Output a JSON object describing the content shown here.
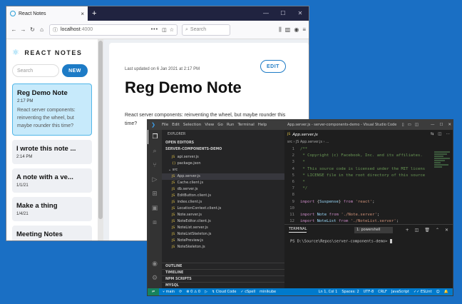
{
  "browser": {
    "tab_title": "React Notes",
    "tab_close": "×",
    "new_tab": "+",
    "url_host": "localhost",
    "url_port": ":4000",
    "url_more": "•••",
    "search_placeholder": "Search"
  },
  "app": {
    "brand": "REACT NOTES",
    "search_placeholder": "Search",
    "new_label": "NEW",
    "notes": [
      {
        "title": "Reg Demo Note",
        "date": "2:17 PM",
        "excerpt": "React server components: reinventing the wheel, but maybe rounder this time?",
        "active": true
      },
      {
        "title": "I wrote this note ...",
        "date": "2:14 PM"
      },
      {
        "title": "A note with a ve...",
        "date": "1/1/21"
      },
      {
        "title": "Make a thing",
        "date": "1/4/21"
      },
      {
        "title": "Meeting Notes",
        "date": ""
      }
    ],
    "detail": {
      "updated": "Last updated on 6 Jan 2021 at 2:17 PM",
      "edit_label": "EDIT",
      "title": "Reg Demo Note",
      "body": "React server components: reinventing the wheel, but maybe rounder this time?"
    }
  },
  "vscode": {
    "menu": [
      "File",
      "Edit",
      "Selection",
      "View",
      "Go",
      "Run",
      "Terminal",
      "Help"
    ],
    "window_title": "App.server.js - server-components-demo - Visual Studio Code",
    "explorer_title": "EXPLORER",
    "open_editors": "OPEN EDITORS",
    "project": "SERVER-COMPONENTS-DEMO",
    "files": [
      {
        "name": "api.server.js",
        "type": "js"
      },
      {
        "name": "package.json",
        "type": "json"
      },
      {
        "name": "src",
        "type": "dir"
      },
      {
        "name": "App.server.js",
        "type": "js",
        "selected": true
      },
      {
        "name": "Cache.client.js",
        "type": "js"
      },
      {
        "name": "db.server.js",
        "type": "js"
      },
      {
        "name": "EditButton.client.js",
        "type": "js"
      },
      {
        "name": "index.client.js",
        "type": "js"
      },
      {
        "name": "LocationContext.client.js",
        "type": "js"
      },
      {
        "name": "Note.server.js",
        "type": "js"
      },
      {
        "name": "NoteEditor.client.js",
        "type": "js"
      },
      {
        "name": "NoteList.server.js",
        "type": "js"
      },
      {
        "name": "NoteListSkeleton.js",
        "type": "js"
      },
      {
        "name": "NotePreview.js",
        "type": "js"
      },
      {
        "name": "NoteSkeleton.js",
        "type": "js"
      }
    ],
    "bottom_sections": [
      "OUTLINE",
      "TIMELINE",
      "NPM SCRIPTS",
      "MYSQL"
    ],
    "editor_tab": "App.server.js",
    "breadcrumb": "src › JS App.server.js › ...",
    "code_lines": [
      {
        "n": "1",
        "text": "/**",
        "cls": "cm"
      },
      {
        "n": "2",
        "text": " * Copyright (c) Facebook, Inc. and its affiliates.",
        "cls": "cm"
      },
      {
        "n": "3",
        "text": " *",
        "cls": "cm"
      },
      {
        "n": "4",
        "text": " * This source code is licensed under the MIT licens",
        "cls": "cm"
      },
      {
        "n": "5",
        "text": " * LICENSE file in the root directory of this source",
        "cls": "cm"
      },
      {
        "n": "6",
        "text": " *",
        "cls": "cm"
      },
      {
        "n": "7",
        "text": " */",
        "cls": "cm"
      },
      {
        "n": "8",
        "text": "",
        "cls": "pl"
      },
      {
        "n": "9",
        "text": "import {Suspense} from 'react';",
        "cls": "imp1"
      },
      {
        "n": "10",
        "text": "",
        "cls": "pl"
      },
      {
        "n": "11",
        "text": "import Note from './Note.server';",
        "cls": "imp2"
      },
      {
        "n": "12",
        "text": "import NoteList from './NoteList.server';",
        "cls": "imp3"
      }
    ],
    "terminal_label": "TERMINAL",
    "terminal_select": "1: powershell",
    "prompt": "PS D:\\Source\\Repos\\server-components-demo>",
    "status": {
      "branch": "main",
      "errors": "0 ⚠ 0",
      "cloud": "Cloud Code",
      "spell": "cSpell",
      "kube": "minikube",
      "position": "Ln 1, Col 1",
      "spaces": "Spaces: 2",
      "encoding": "UTF-8",
      "eol": "CRLF",
      "language": "JavaScript",
      "lint": "ESLint"
    }
  }
}
